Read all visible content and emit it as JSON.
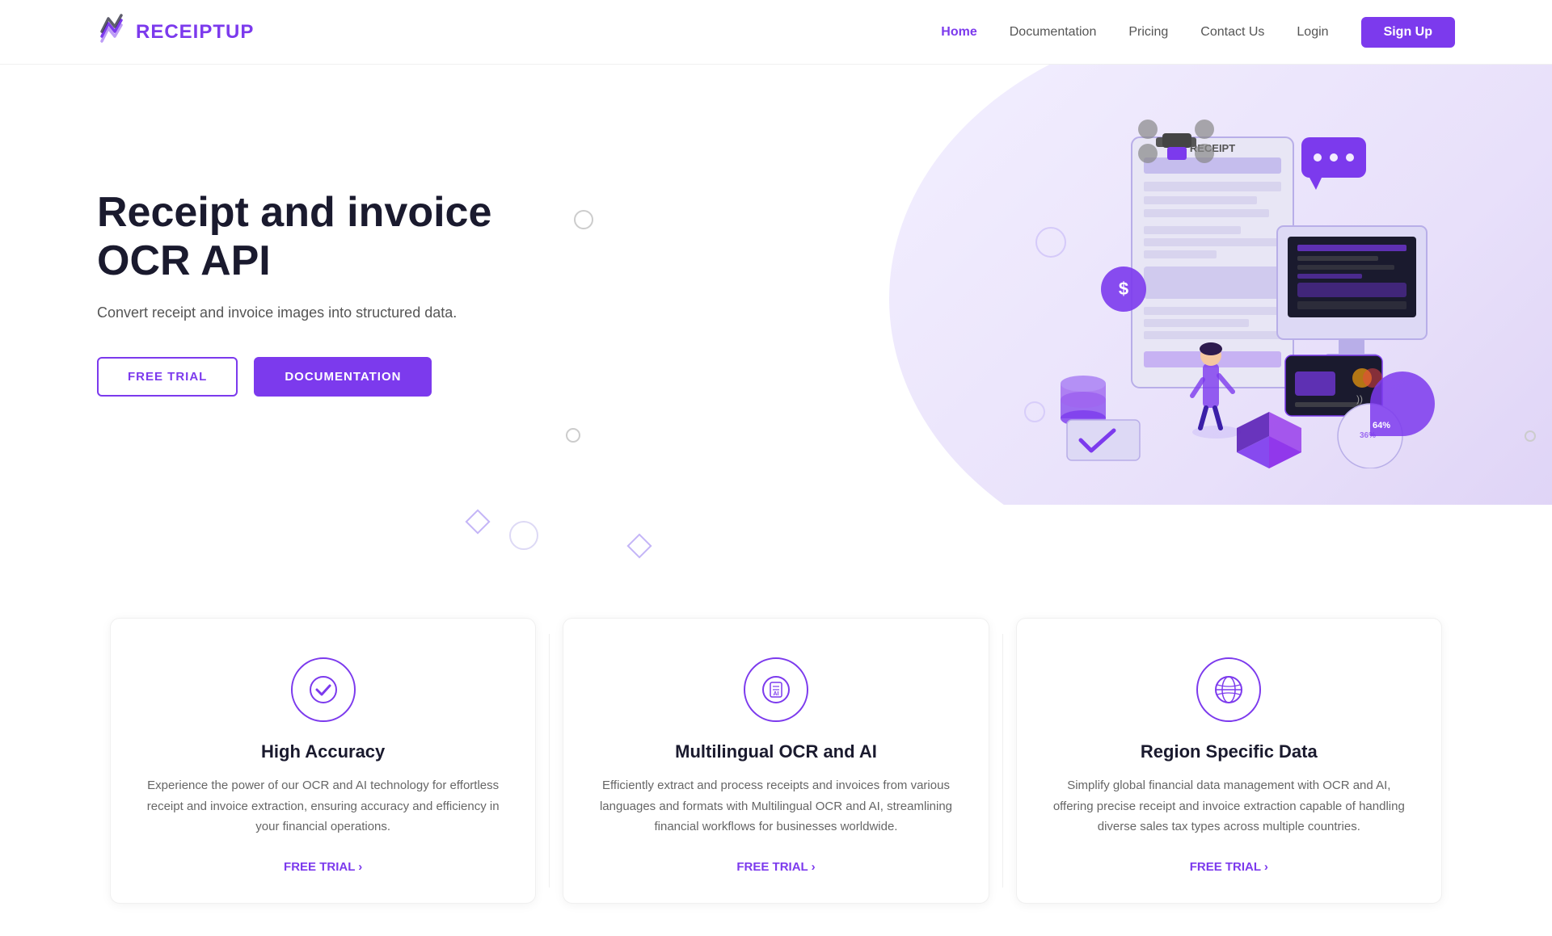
{
  "brand": {
    "name_part1": "RECEIPT",
    "name_part2": "UP"
  },
  "nav": {
    "links": [
      {
        "label": "Home",
        "active": true,
        "id": "home"
      },
      {
        "label": "Documentation",
        "active": false,
        "id": "documentation"
      },
      {
        "label": "Pricing",
        "active": false,
        "id": "pricing"
      },
      {
        "label": "Contact Us",
        "active": false,
        "id": "contact"
      },
      {
        "label": "Login",
        "active": false,
        "id": "login"
      },
      {
        "label": "Sign Up",
        "active": false,
        "id": "signup"
      }
    ]
  },
  "hero": {
    "title": "Receipt and invoice OCR API",
    "subtitle": "Convert receipt and invoice images into structured data.",
    "btn_free_trial": "FREE TRIAL",
    "btn_documentation": "DOCUMENTATION"
  },
  "features": [
    {
      "id": "high-accuracy",
      "title": "High Accuracy",
      "description": "Experience the power of our OCR and AI technology for effortless receipt and invoice extraction, ensuring accuracy and efficiency in your financial operations.",
      "link": "FREE TRIAL ›",
      "icon": "checkmark"
    },
    {
      "id": "multilingual-ocr",
      "title": "Multilingual OCR and AI",
      "description": "Efficiently extract and process receipts and invoices from various languages and formats with Multilingual OCR and AI, streamlining financial workflows for businesses worldwide.",
      "link": "FREE TRIAL ›",
      "icon": "ai-doc"
    },
    {
      "id": "region-specific",
      "title": "Region Specific Data",
      "description": "Simplify global financial data management with OCR and AI, offering precise receipt and invoice extraction capable of handling diverse sales tax types across multiple countries.",
      "link": "FREE TRIAL ›",
      "icon": "globe"
    }
  ]
}
